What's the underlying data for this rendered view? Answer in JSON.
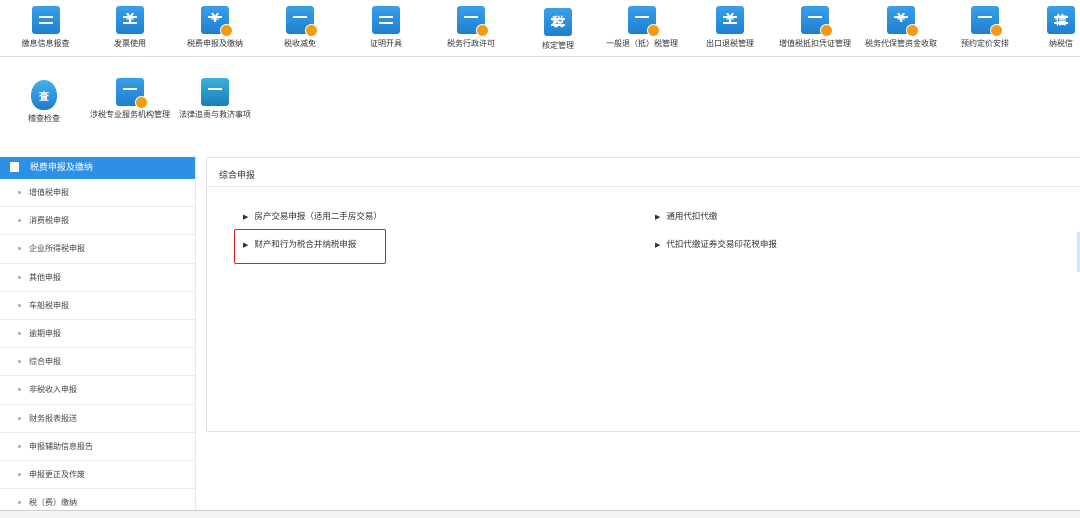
{
  "toolbar_row1": [
    {
      "label": "缴息信息报查",
      "icon": "document-icon",
      "glyph": ""
    },
    {
      "label": "发票使用",
      "icon": "invoice-icon",
      "glyph": "¥"
    },
    {
      "label": "税费申报及缴纳",
      "icon": "tax-payment-icon",
      "glyph": "¥"
    },
    {
      "label": "税收减免",
      "icon": "tax-relief-icon",
      "glyph": ""
    },
    {
      "label": "证明开具",
      "icon": "certificate-icon",
      "glyph": ""
    },
    {
      "label": "税务行政许可",
      "icon": "admin-license-icon",
      "glyph": ""
    },
    {
      "label": "核定管理",
      "icon": "assessment-icon",
      "glyph": "税"
    },
    {
      "label": "一般退（抵）税管理",
      "icon": "refund-icon",
      "glyph": ""
    },
    {
      "label": "出口退税管理",
      "icon": "export-refund-icon",
      "glyph": "¥"
    },
    {
      "label": "增值税抵扣凭证管理",
      "icon": "vat-voucher-icon",
      "glyph": ""
    },
    {
      "label": "税务代保管资金收取",
      "icon": "custody-fund-icon",
      "glyph": "¥"
    },
    {
      "label": "预约定价安排",
      "icon": "pricing-arrangement-icon",
      "glyph": ""
    },
    {
      "label": "纳税信",
      "icon": "credit-icon",
      "glyph": "信"
    }
  ],
  "toolbar_row2": [
    {
      "label": "稽查检查",
      "icon": "inspection-shield-icon",
      "glyph": "查"
    },
    {
      "label": "涉税专业服务机构管理",
      "icon": "agency-management-icon",
      "glyph": ""
    },
    {
      "label": "法律追责与救济事项",
      "icon": "legal-remedy-icon",
      "glyph": ""
    }
  ],
  "sidebar": {
    "header": "税费申报及缴纳",
    "items": [
      "增值税申报",
      "消费税申报",
      "企业所得税申报",
      "其他申报",
      "车船税申报",
      "逾期申报",
      "综合申报",
      "非税收入申报",
      "财务报表报送",
      "申报辅助信息报告",
      "申报更正及作废",
      "税（费）缴纳"
    ]
  },
  "panel": {
    "title": "综合申报",
    "links": [
      "房产交易申报（适用二手房交易）",
      "通用代扣代缴",
      "财产和行为税合并纳税申报",
      "代扣代缴证券交易印花税申报"
    ]
  },
  "colors": {
    "accent": "#2d8fe6",
    "highlight": "#e02020"
  }
}
